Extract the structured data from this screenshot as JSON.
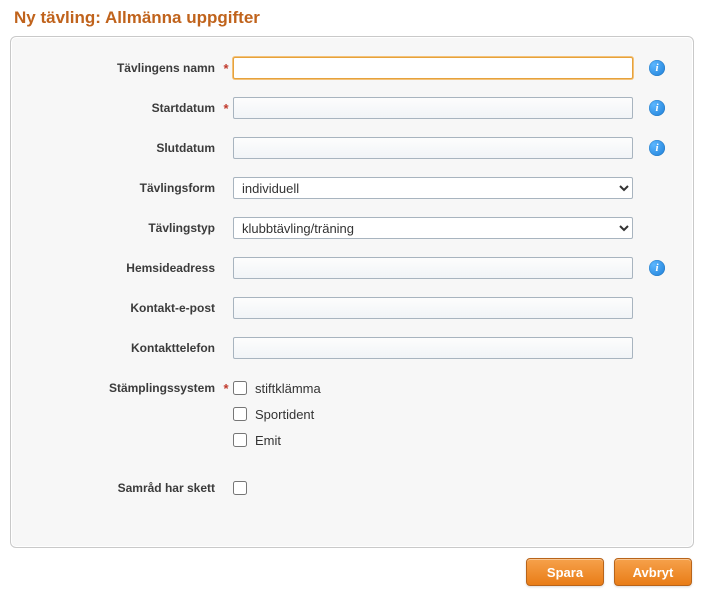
{
  "title": "Ny tävling: Allmänna uppgifter",
  "labels": {
    "name": "Tävlingens namn",
    "start": "Startdatum",
    "end": "Slutdatum",
    "form": "Tävlingsform",
    "type": "Tävlingstyp",
    "url": "Hemsideadress",
    "email": "Kontakt-e-post",
    "phone": "Kontakttelefon",
    "punch": "Stämplingssystem",
    "consult": "Samråd har skett"
  },
  "required_marker": "*",
  "values": {
    "name": "",
    "start": "",
    "end": "",
    "form": "individuell",
    "type": "klubbtävling/träning",
    "url": "",
    "email": "",
    "phone": ""
  },
  "punch_options": {
    "stift": "stiftklämma",
    "sportident": "Sportident",
    "emit": "Emit"
  },
  "buttons": {
    "save": "Spara",
    "cancel": "Avbryt"
  },
  "info_glyph": "i"
}
